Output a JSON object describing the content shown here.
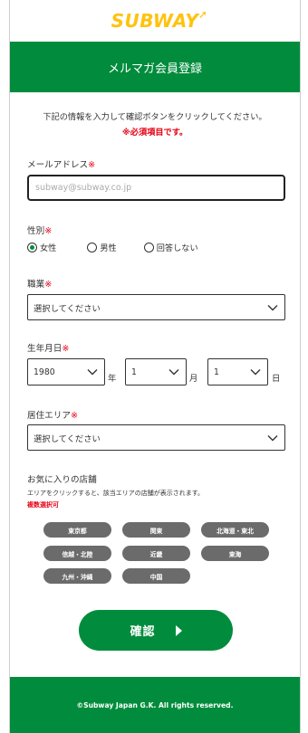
{
  "brand": {
    "logo_text": "SUBWAY",
    "green": "#008c3c",
    "yellow": "#ffc20e",
    "required_red": "#e60012"
  },
  "header": {
    "title": "メルマガ会員登録"
  },
  "intro": {
    "text": "下記の情報を入力して確認ボタンをクリックしてください。",
    "required_note": "※必須項目です。"
  },
  "required_mark": "※",
  "email": {
    "label": "メールアドレス",
    "value": "",
    "placeholder": "subway@subway.co.jp"
  },
  "gender": {
    "label": "性別",
    "options": [
      {
        "label": "女性",
        "selected": true
      },
      {
        "label": "男性",
        "selected": false
      },
      {
        "label": "回答しない",
        "selected": false
      }
    ]
  },
  "occupation": {
    "label": "職業",
    "value": "選択してください"
  },
  "birthdate": {
    "label": "生年月日",
    "year": {
      "value": "1980",
      "unit": "年"
    },
    "month": {
      "value": "1",
      "unit": "月"
    },
    "day": {
      "value": "1",
      "unit": "日"
    }
  },
  "area": {
    "label": "居住エリア",
    "value": "選択してください"
  },
  "favorite_store": {
    "label": "お気に入りの店舗",
    "note": "エリアをクリックすると、該当エリアの店舗が表示されます。",
    "multi_note": "複数選択可",
    "regions": [
      "東京都",
      "関東",
      "北海道・東北",
      "信越・北陸",
      "近畿",
      "東海",
      "九州・沖縄",
      "中国"
    ]
  },
  "confirm_button": {
    "label": "確認"
  },
  "footer": {
    "copyright": "©Subway Japan G.K. All rights reserved."
  }
}
